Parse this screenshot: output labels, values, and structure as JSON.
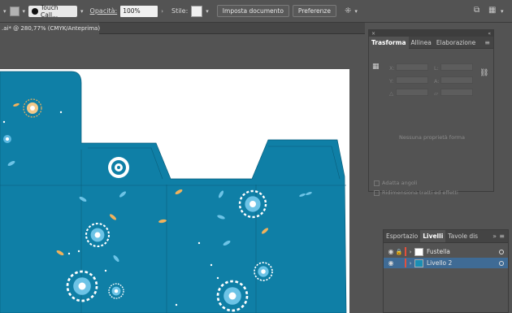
{
  "control_bar": {
    "brush_name": "Touch Call...",
    "opacity_label": "Opacità:",
    "opacity_value": "100%",
    "style_label": "Stile:",
    "document_setup_label": "Imposta documento",
    "preferences_label": "Preferenze"
  },
  "document": {
    "tab_title": ".ai* @ 280,77% (CMYK/Anteprima)"
  },
  "transform_panel": {
    "tabs": [
      "Trasforma",
      "Allinea",
      "Elaborazione"
    ],
    "empty_message": "Nessuna proprietà forma",
    "field_labels": [
      "X:",
      "Y:",
      "L:",
      "A:"
    ],
    "checkboxes": [
      "Adatta angoli",
      "Ridimensiona tratti ed effetti"
    ]
  },
  "layers_panel": {
    "tabs": [
      "Esportazio",
      "Livelli",
      "Tavole dis"
    ],
    "layers": [
      {
        "name": "Fustella",
        "color": "#e3503c",
        "selected": false
      },
      {
        "name": "Livello 2",
        "color": "#e3503c",
        "selected": true
      }
    ]
  },
  "colors": {
    "artwork_teal": "#0f7fa6",
    "artboard": "#ffffff",
    "selection": "#3f6b95"
  },
  "icons": [
    "chevron-down-icon",
    "stroke-swatch-icon",
    "brush-dot-icon",
    "puppet-warp-icon",
    "arrange-icon",
    "grid-icon",
    "eye-icon",
    "lock-icon",
    "target-icon",
    "panel-menu-icon",
    "reference-point-icon",
    "constrain-icon"
  ]
}
